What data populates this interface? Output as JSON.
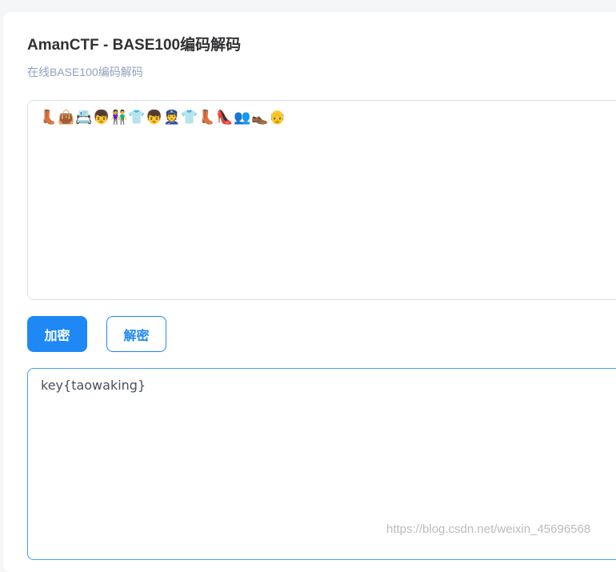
{
  "page": {
    "title": "AmanCTF - BASE100编码解码",
    "subtitle": "在线BASE100编码解码"
  },
  "input": {
    "emojis": [
      "👢",
      "👜",
      "📇",
      "👦",
      "👫",
      "👕",
      "👦",
      "👮",
      "👕",
      "👢",
      "👠",
      "👥",
      "👞",
      "👴"
    ]
  },
  "buttons": {
    "encrypt_label": "加密",
    "decrypt_label": "解密"
  },
  "output": {
    "value": "key{taowaking}"
  },
  "watermark": {
    "text": "https://blog.csdn.net/weixin_45696568"
  },
  "colors": {
    "primary": "#1e88f5",
    "subtitle": "#8fa3bd",
    "title": "#303133"
  }
}
